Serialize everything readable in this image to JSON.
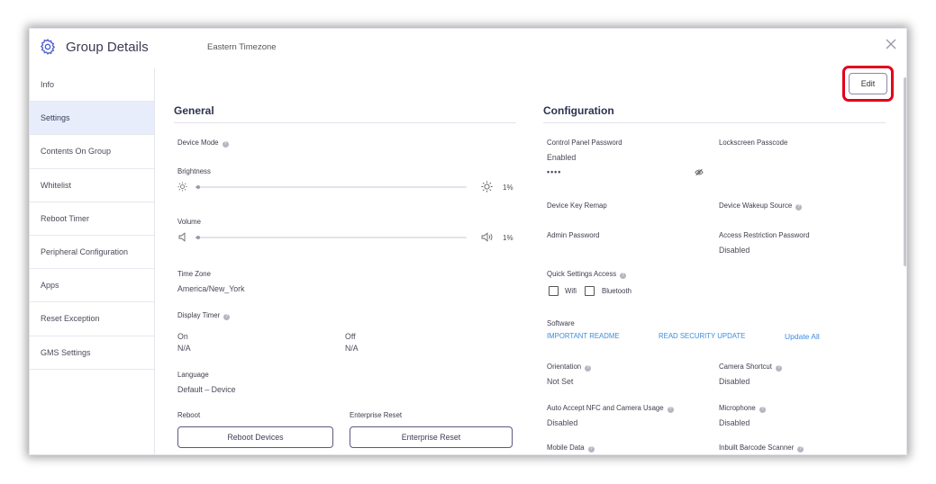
{
  "header": {
    "title": "Group Details",
    "subtitle": "Eastern Timezone"
  },
  "sidebar": {
    "items": [
      {
        "label": "Info"
      },
      {
        "label": "Settings"
      },
      {
        "label": "Contents On Group"
      },
      {
        "label": "Whitelist"
      },
      {
        "label": "Reboot Timer"
      },
      {
        "label": "Peripheral Configuration"
      },
      {
        "label": "Apps"
      },
      {
        "label": "Reset Exception"
      },
      {
        "label": "GMS Settings"
      }
    ],
    "active_item": "Settings"
  },
  "toolbar": {
    "edit_label": "Edit"
  },
  "general": {
    "title": "General",
    "device_mode_label": "Device Mode",
    "brightness_label": "Brightness",
    "brightness_value": "1%",
    "brightness_level": 0.01,
    "volume_label": "Volume",
    "volume_value": "1%",
    "volume_level": 0.01,
    "time_zone_label": "Time Zone",
    "time_zone_value": "America/New_York",
    "display_timer_label": "Display Timer",
    "on_label": "On",
    "on_value": "N/A",
    "off_label": "Off",
    "off_value": "N/A",
    "language_label": "Language",
    "language_value": "Default – Device",
    "reboot_label": "Reboot",
    "reboot_button": "Reboot Devices",
    "enterprise_reset_label": "Enterprise Reset",
    "enterprise_reset_button": "Enterprise Reset"
  },
  "configuration": {
    "title": "Configuration",
    "control_panel_password_label": "Control Panel Password",
    "control_panel_password_status": "Enabled",
    "control_panel_password_value": "••••",
    "lockscreen_passcode_label": "Lockscreen Passcode",
    "device_key_remap_label": "Device Key Remap",
    "device_wakeup_source_label": "Device Wakeup Source",
    "admin_password_label": "Admin Password",
    "access_restriction_password_label": "Access Restriction Password",
    "access_restriction_password_value": "Disabled",
    "quick_settings_access_label": "Quick Settings Access",
    "wifi_label": "Wifi",
    "bluetooth_label": "Bluetooth",
    "software_label": "Software",
    "important_readme_link": "IMPORTANT README",
    "read_security_update_link": "READ SECURITY UPDATE",
    "update_all_link": "Update All",
    "orientation_label": "Orientation",
    "orientation_value": "Not Set",
    "camera_shortcut_label": "Camera Shortcut",
    "camera_shortcut_value": "Disabled",
    "auto_accept_nfc_label": "Auto Accept NFC and Camera Usage",
    "auto_accept_nfc_value": "Disabled",
    "microphone_label": "Microphone",
    "microphone_value": "Disabled",
    "mobile_data_label": "Mobile Data",
    "inbuilt_barcode_scanner_label": "Inbuilt Barcode Scanner"
  },
  "colors": {
    "highlight_border": "#e3001b",
    "link": "#3a8dde",
    "active_sidebar_bg": "#e8edfb",
    "title": "#2d3350"
  },
  "icons": [
    "gear-icon",
    "close-icon",
    "sun-icon",
    "speaker-icon",
    "eye-slash-icon",
    "help-icon"
  ]
}
